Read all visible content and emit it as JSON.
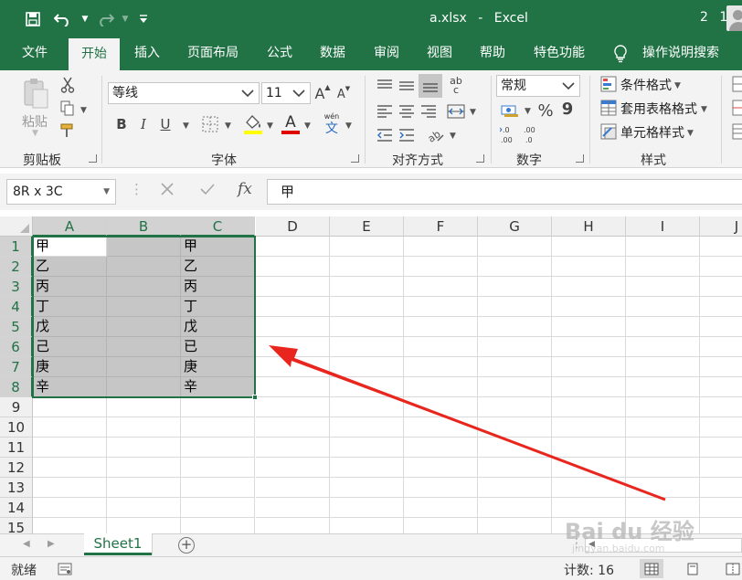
{
  "titlebar": {
    "filename": "a.xlsx",
    "separator": "-",
    "app": "Excel",
    "user_initials": "2 1"
  },
  "tabs": [
    {
      "label": "文件",
      "active": false
    },
    {
      "label": "开始",
      "active": true
    },
    {
      "label": "插入",
      "active": false
    },
    {
      "label": "页面布局",
      "active": false
    },
    {
      "label": "公式",
      "active": false
    },
    {
      "label": "数据",
      "active": false
    },
    {
      "label": "审阅",
      "active": false
    },
    {
      "label": "视图",
      "active": false
    },
    {
      "label": "帮助",
      "active": false
    },
    {
      "label": "特色功能",
      "active": false
    }
  ],
  "tell_me": "操作说明搜索",
  "ribbon": {
    "clipboard": {
      "paste": "粘贴",
      "label": "剪贴板"
    },
    "font": {
      "family": "等线",
      "size": "11",
      "bold": "B",
      "italic": "I",
      "underline": "U",
      "phonetic_top": "wén",
      "phonetic_bottom": "文",
      "font_color": "A",
      "label": "字体"
    },
    "alignment": {
      "label": "对齐方式",
      "ab": "ab",
      "c": "c"
    },
    "number": {
      "format": "常规",
      "percent": "%",
      "comma": "9",
      "label": "数字",
      "inc_decimal": ".0 .00",
      "dec_decimal": ".00 .0"
    },
    "styles": {
      "conditional": "条件格式",
      "table": "套用表格格式",
      "cell": "单元格样式",
      "label": "样式"
    }
  },
  "formula_bar": {
    "name_box": "8R x 3C",
    "fx": "fx",
    "value": "甲"
  },
  "grid": {
    "columns": [
      "A",
      "B",
      "C",
      "D",
      "E",
      "F",
      "G",
      "H",
      "I",
      "J"
    ],
    "rows": [
      "1",
      "2",
      "3",
      "4",
      "5",
      "6",
      "7",
      "8",
      "9",
      "10",
      "11",
      "12",
      "13",
      "14",
      "15"
    ],
    "col_a": [
      "甲",
      "乙",
      "丙",
      "丁",
      "戊",
      "己",
      "庚",
      "辛"
    ],
    "col_c": [
      "甲",
      "乙",
      "丙",
      "丁",
      "戊",
      "已",
      "庚",
      "辛"
    ]
  },
  "sheets": [
    {
      "name": "Sheet1",
      "active": true
    }
  ],
  "status": {
    "ready": "就绪",
    "count": "计数: 16"
  },
  "colors": {
    "brand": "#217346",
    "arrow": "#e8261e"
  },
  "watermark": {
    "main": "Bai du 经验",
    "sub": "jingyan.baidu.com"
  }
}
